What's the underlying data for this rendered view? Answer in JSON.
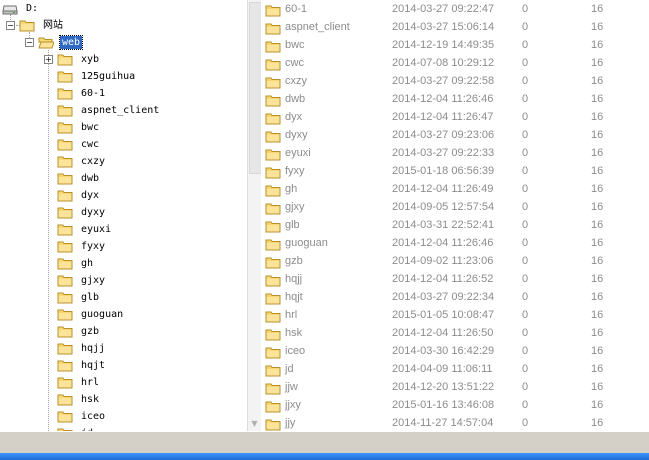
{
  "tree": {
    "drive_label": "D:",
    "root_folder": "网站",
    "selected_folder": "web",
    "children": [
      "xyb",
      "125guihua",
      "60-1",
      "aspnet_client",
      "bwc",
      "cwc",
      "cxzy",
      "dwb",
      "dyx",
      "dyxy",
      "eyuxi",
      "fyxy",
      "gh",
      "gjxy",
      "glb",
      "guoguan",
      "gzb",
      "hqjj",
      "hqjt",
      "hrl",
      "hsk",
      "iceo",
      "jd"
    ]
  },
  "list": {
    "rows": [
      {
        "name": "60-1",
        "date": "2014-03-27 09:22:47",
        "size": "0",
        "attr": "16"
      },
      {
        "name": "aspnet_client",
        "date": "2014-03-27 15:06:14",
        "size": "0",
        "attr": "16"
      },
      {
        "name": "bwc",
        "date": "2014-12-19 14:49:35",
        "size": "0",
        "attr": "16"
      },
      {
        "name": "cwc",
        "date": "2014-07-08 10:29:12",
        "size": "0",
        "attr": "16"
      },
      {
        "name": "cxzy",
        "date": "2014-03-27 09:22:58",
        "size": "0",
        "attr": "16"
      },
      {
        "name": "dwb",
        "date": "2014-12-04 11:26:46",
        "size": "0",
        "attr": "16"
      },
      {
        "name": "dyx",
        "date": "2014-12-04 11:26:47",
        "size": "0",
        "attr": "16"
      },
      {
        "name": "dyxy",
        "date": "2014-03-27 09:23:06",
        "size": "0",
        "attr": "16"
      },
      {
        "name": "eyuxi",
        "date": "2014-03-27 09:22:33",
        "size": "0",
        "attr": "16"
      },
      {
        "name": "fyxy",
        "date": "2015-01-18 06:56:39",
        "size": "0",
        "attr": "16"
      },
      {
        "name": "gh",
        "date": "2014-12-04 11:26:49",
        "size": "0",
        "attr": "16"
      },
      {
        "name": "gjxy",
        "date": "2014-09-05 12:57:54",
        "size": "0",
        "attr": "16"
      },
      {
        "name": "glb",
        "date": "2014-03-31 22:52:41",
        "size": "0",
        "attr": "16"
      },
      {
        "name": "guoguan",
        "date": "2014-12-04 11:26:46",
        "size": "0",
        "attr": "16"
      },
      {
        "name": "gzb",
        "date": "2014-09-02 11:23:06",
        "size": "0",
        "attr": "16"
      },
      {
        "name": "hqjj",
        "date": "2014-12-04 11:26:52",
        "size": "0",
        "attr": "16"
      },
      {
        "name": "hqjt",
        "date": "2014-03-27 09:22:34",
        "size": "0",
        "attr": "16"
      },
      {
        "name": "hrl",
        "date": "2015-01-05 10:08:47",
        "size": "0",
        "attr": "16"
      },
      {
        "name": "hsk",
        "date": "2014-12-04 11:26:50",
        "size": "0",
        "attr": "16"
      },
      {
        "name": "iceo",
        "date": "2014-03-30 16:42:29",
        "size": "0",
        "attr": "16"
      },
      {
        "name": "jd",
        "date": "2014-04-09 11:06:11",
        "size": "0",
        "attr": "16"
      },
      {
        "name": "jjw",
        "date": "2014-12-20 13:51:22",
        "size": "0",
        "attr": "16"
      },
      {
        "name": "jjxy",
        "date": "2015-01-16 13:46:08",
        "size": "0",
        "attr": "16"
      },
      {
        "name": "jjy",
        "date": "2014-11-27 14:57:04",
        "size": "0",
        "attr": "16"
      }
    ]
  },
  "icons": {
    "folder": "folder-icon",
    "drive": "drive-icon",
    "expand": "expand-icon",
    "collapse": "collapse-icon"
  },
  "colors": {
    "folder_fill": "#f8d775",
    "folder_edge": "#b8902a",
    "selection": "#316ac5",
    "list_text": "#8c8c8c",
    "statusbar": "#d4d0c8",
    "taskbar": "#1f6bd6"
  }
}
